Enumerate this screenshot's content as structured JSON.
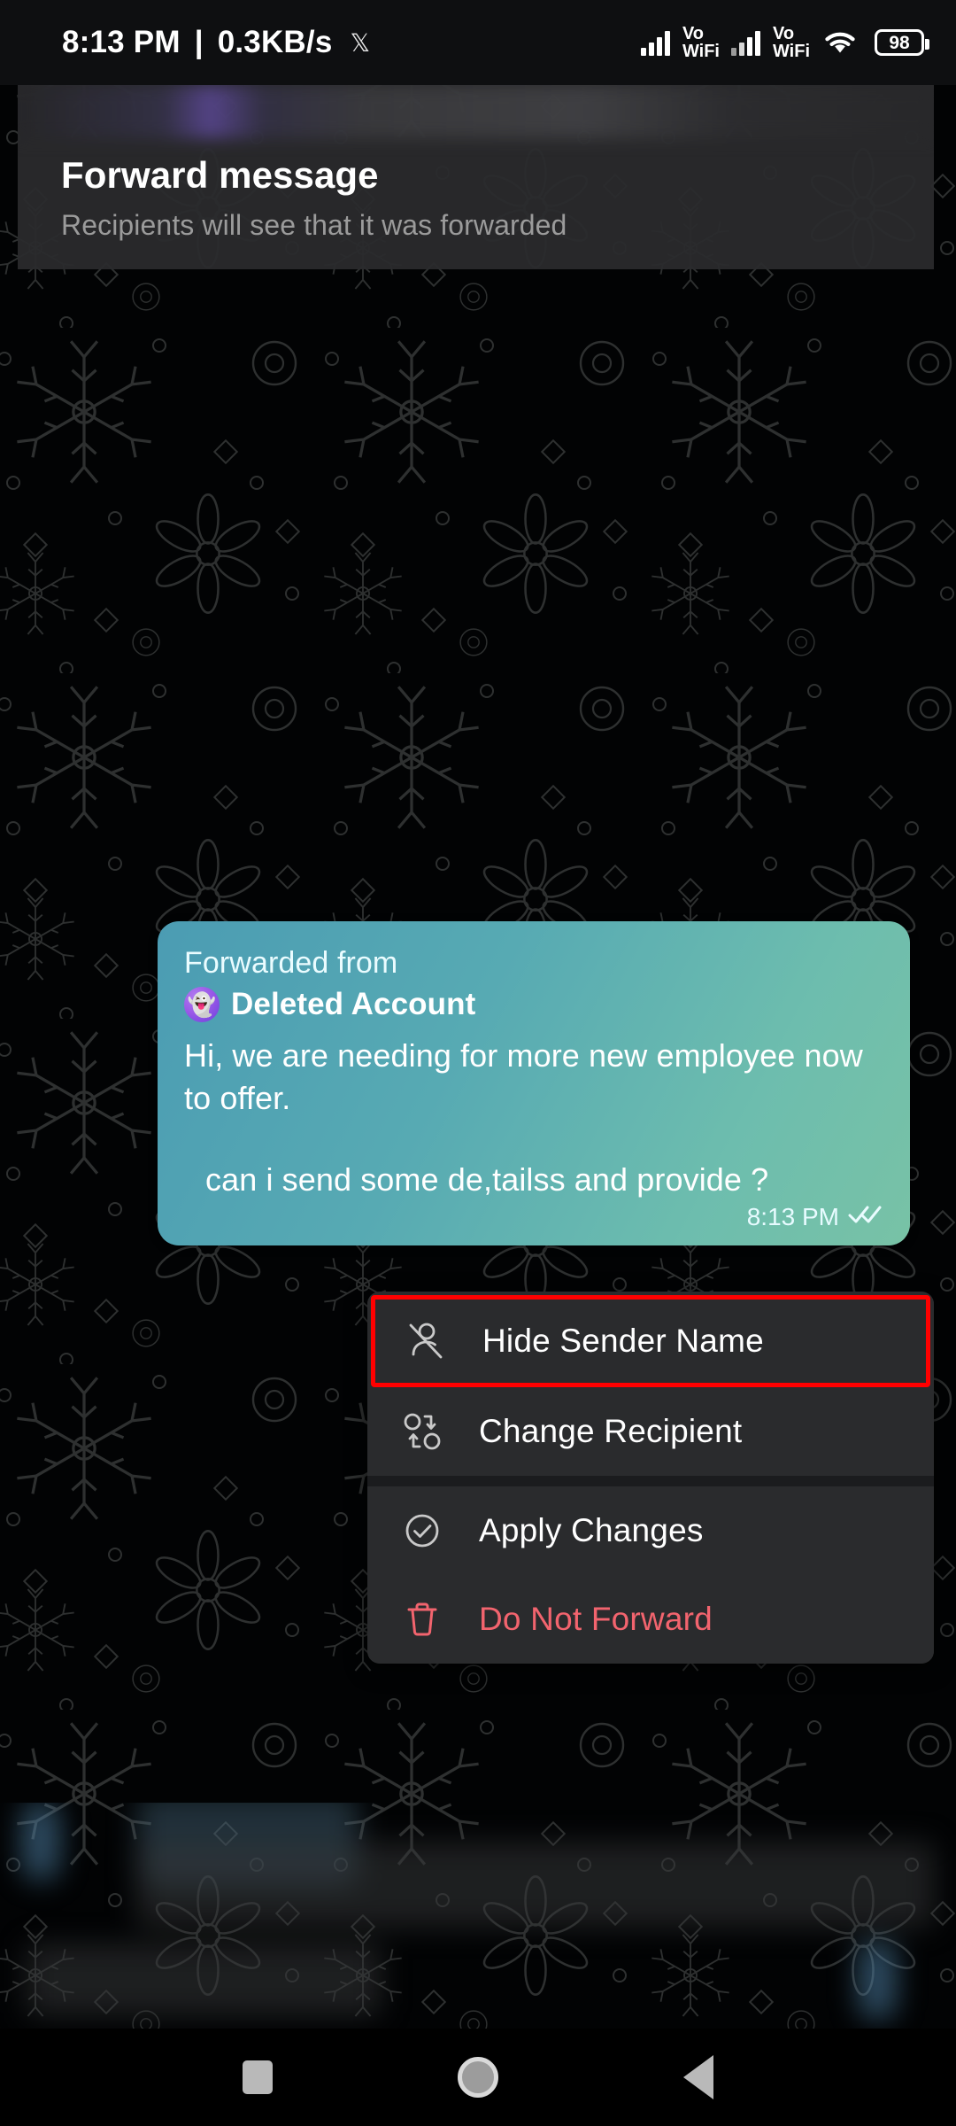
{
  "status_bar": {
    "time": "8:13 PM",
    "separator": "|",
    "network_speed": "0.3KB/s",
    "app_badge": "𝕏",
    "sim1_label_top": "Vo",
    "sim1_label_bottom": "WiFi",
    "sim2_label_top": "Vo",
    "sim2_label_bottom": "WiFi",
    "battery_level": "98"
  },
  "forward_header": {
    "title": "Forward message",
    "subtitle": "Recipients will see that it was forwarded"
  },
  "message": {
    "forwarded_label": "Forwarded from",
    "sender_name": "Deleted Account",
    "sender_avatar_glyph": "👻",
    "line1": "Hi, we are needing for more new employee now to offer.",
    "line2": "can i send some de,tailss and provide  ?",
    "time": "8:13 PM",
    "read_status": "read-double-check"
  },
  "context_menu": {
    "groups": [
      {
        "items": [
          {
            "label": "Hide Sender Name",
            "icon": "person-slash-icon",
            "highlighted": true,
            "danger": false
          },
          {
            "label": "Change Recipient",
            "icon": "swap-users-icon",
            "highlighted": false,
            "danger": false
          }
        ]
      },
      {
        "items": [
          {
            "label": "Apply Changes",
            "icon": "check-circle-icon",
            "highlighted": false,
            "danger": false
          },
          {
            "label": "Do Not Forward",
            "icon": "trash-icon",
            "highlighted": false,
            "danger": true
          }
        ]
      }
    ],
    "highlight_color": "#ff0000",
    "danger_color": "#f2646e"
  },
  "nav_bar": {
    "recents_label": "Recents",
    "home_label": "Home",
    "back_label": "Back"
  },
  "colors": {
    "bubble_start": "#4b9cb3",
    "bubble_end": "#78c2a6",
    "menu_bg": "#2a2b2d",
    "header_bg": "#2a2b2d",
    "avatar_purple": "#9b5ae8"
  }
}
